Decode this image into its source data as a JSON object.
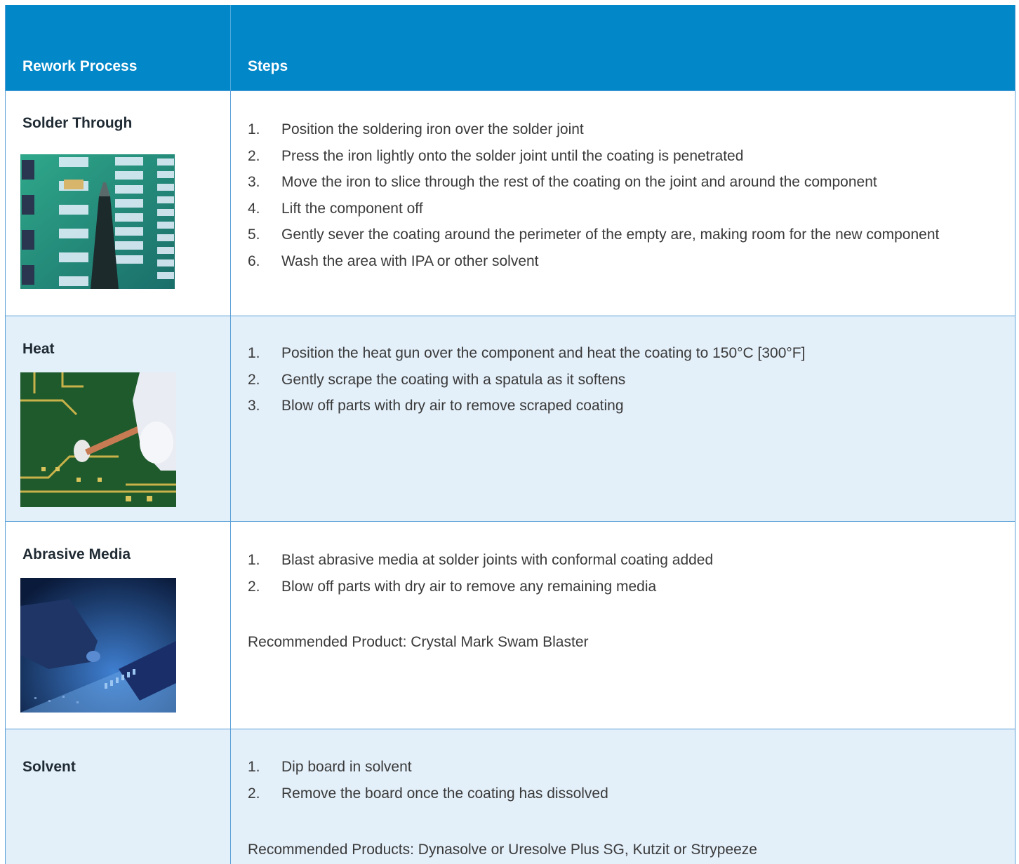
{
  "header": {
    "col1": "Rework Process",
    "col2": "Steps"
  },
  "rows": [
    {
      "name": "Solder Through",
      "steps": [
        "Position the soldering iron over the solder joint",
        "Press the iron lightly onto the solder joint until the coating is penetrated",
        "Move the iron to slice through the rest of the coating on the joint and around the component",
        "Lift the component off",
        "Gently sever the coating around the perimeter of the empty are, making room for the new component",
        "Wash the area with IPA or other solvent"
      ]
    },
    {
      "name": "Heat",
      "steps": [
        "Position the heat gun over the component and heat the coating to 150°C [300°F]",
        "Gently scrape the coating with a spatula as it softens",
        "Blow off parts with dry air to remove scraped coating"
      ]
    },
    {
      "name": "Abrasive Media",
      "steps": [
        "Blast abrasive media at solder joints with conformal coating added",
        "Blow off parts with dry air to remove any remaining media"
      ],
      "recommended": "Recommended Product: Crystal Mark Swam Blaster"
    },
    {
      "name": "Solvent",
      "steps": [
        "Dip board in solvent",
        "Remove the board once the coating has dissolved"
      ],
      "recommended": "Recommended Products: Dynasolve or Uresolve Plus SG, Kutzit or Strypeeze"
    }
  ],
  "step_numbers": [
    "1.",
    "2.",
    "3.",
    "4.",
    "5.",
    "6."
  ],
  "colors": {
    "header_bg": "#0287c8",
    "row_tint": "#e3eff9",
    "border": "#5aa0d8"
  }
}
